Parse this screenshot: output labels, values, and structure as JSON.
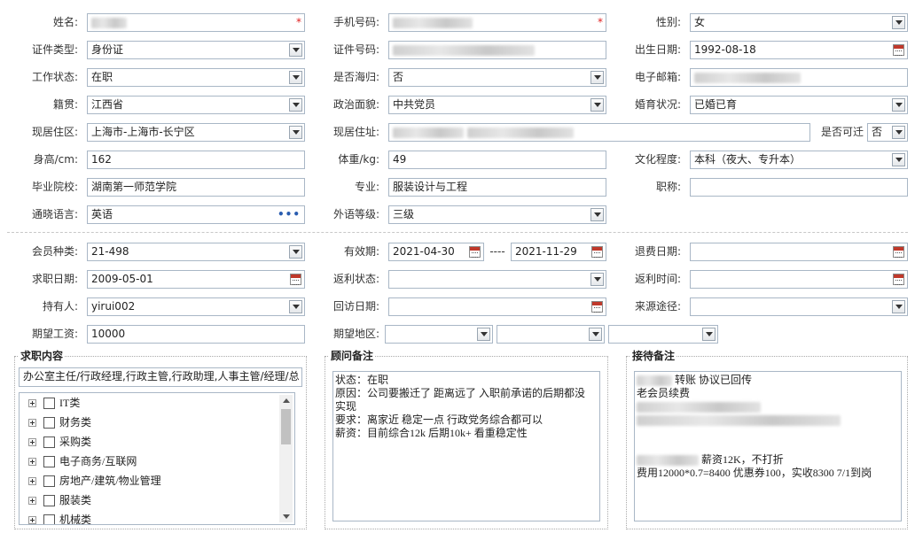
{
  "row1": {
    "name_label": "姓名:",
    "phone_label": "手机号码:",
    "gender_label": "性别:",
    "gender_value": "女"
  },
  "row2": {
    "id_type_label": "证件类型:",
    "id_type_value": "身份证",
    "id_number_label": "证件号码:",
    "birth_label": "出生日期:",
    "birth_value": "1992-08-18"
  },
  "row3": {
    "work_status_label": "工作状态:",
    "work_status_value": "在职",
    "returnee_label": "是否海归:",
    "returnee_value": "否",
    "email_label": "电子邮箱:"
  },
  "row4": {
    "native_label": "籍贯:",
    "native_value": "江西省",
    "political_label": "政治面貌:",
    "political_value": "中共党员",
    "marital_label": "婚育状况:",
    "marital_value": "已婚已育"
  },
  "row5": {
    "residence_area_label": "现居住区:",
    "residence_area_value": "上海市-上海市-长宁区",
    "address_label": "现居住址:",
    "relocate_label": "是否可迁",
    "relocate_value": "否"
  },
  "row6": {
    "height_label": "身高/cm:",
    "height_value": "162",
    "weight_label": "体重/kg:",
    "weight_value": "49",
    "education_label": "文化程度:",
    "education_value": "本科（夜大、专升本）"
  },
  "row7": {
    "school_label": "毕业院校:",
    "school_value": "湖南第一师范学院",
    "major_label": "专业:",
    "major_value": "服装设计与工程",
    "title_label": "职称:"
  },
  "row8": {
    "language_label": "通晓语言:",
    "language_value": "英语",
    "language_more": "•••",
    "lang_level_label": "外语等级:",
    "lang_level_value": "三级"
  },
  "row9": {
    "member_type_label": "会员种类:",
    "member_type_value": "21-498",
    "valid_label": "有效期:",
    "valid_from": "2021-04-30",
    "valid_sep": "----",
    "valid_to": "2021-11-29",
    "refund_date_label": "退费日期:"
  },
  "row10": {
    "job_date_label": "求职日期:",
    "job_date_value": "2009-05-01",
    "rebate_status_label": "返利状态:",
    "rebate_time_label": "返利时间:"
  },
  "row11": {
    "holder_label": "持有人:",
    "holder_value": "yirui002",
    "visit_date_label": "回访日期:",
    "source_label": "来源途径:"
  },
  "row12": {
    "salary_label": "期望工资:",
    "salary_value": "10000",
    "region_label": "期望地区:"
  },
  "job_box": {
    "title": "求职内容",
    "summary": "办公室主任/行政经理,行政主管,行政助理,人事主管/经理/总",
    "categories": [
      "IT类",
      "财务类",
      "采购类",
      "电子商务/互联网",
      "房地产/建筑/物业管理",
      "服装类",
      "机械类"
    ]
  },
  "advisor_box": {
    "title": "顾问备注",
    "lines": [
      "状态：在职",
      "原因：公司要搬迁了 距离远了 入职前承诺的后期都没",
      "实现",
      "要求：离家近 稳定一点   行政党务综合都可以",
      "薪资：目前综合12k  后期10k+ 看重稳定性"
    ]
  },
  "reception_box": {
    "title": "接待备注",
    "line1": "转账 协议已回传",
    "line2": "老会员续费",
    "line3": "薪资12K，不打折",
    "line4": "费用12000*0.7=8400 优惠券100，实收8300  7/1到岗"
  },
  "colors": {
    "required": "#e02020",
    "border": "#a9b7c6",
    "link_dots": "#2a5db0"
  }
}
